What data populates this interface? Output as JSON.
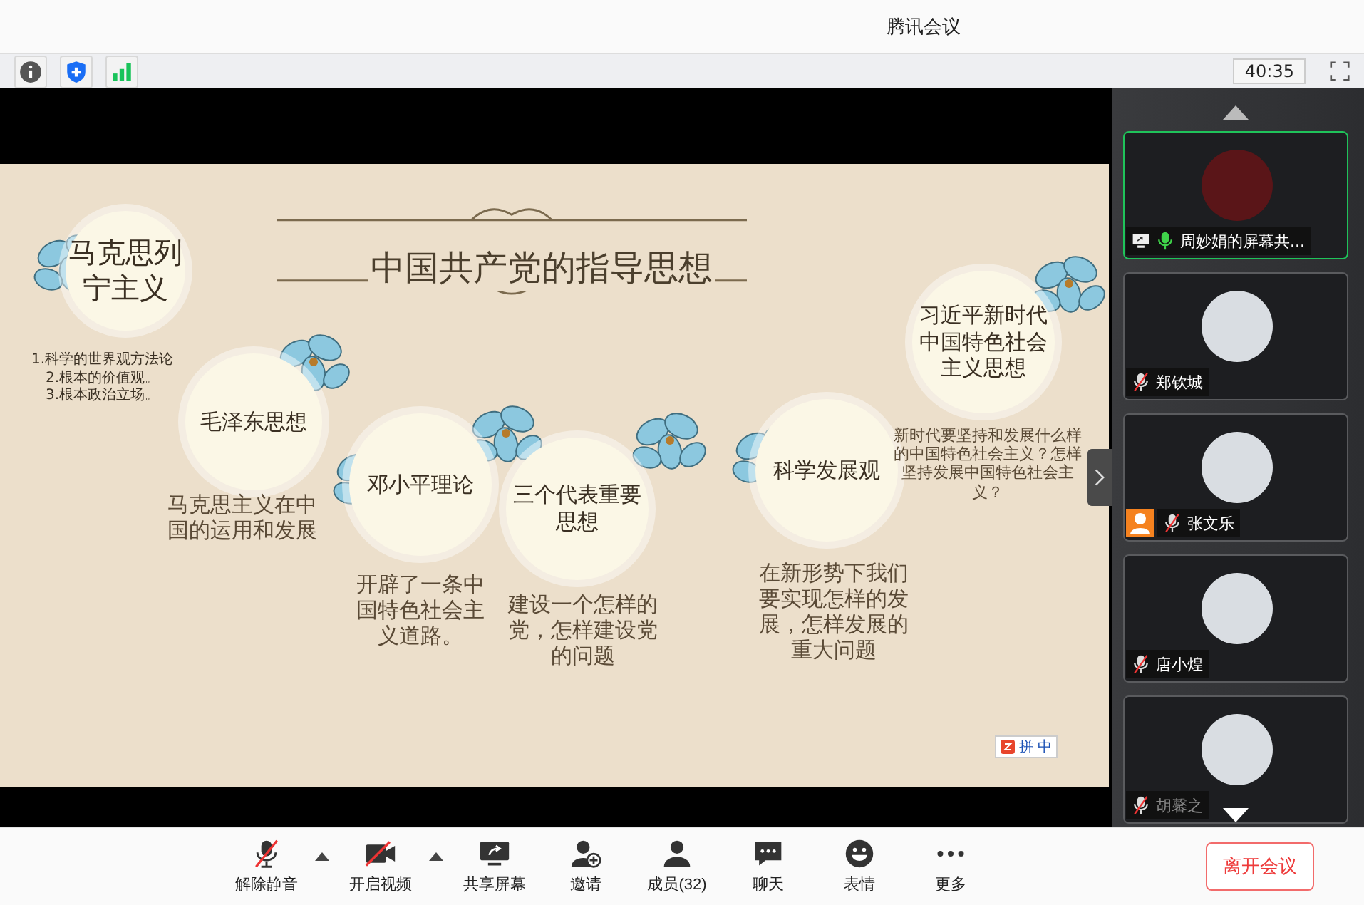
{
  "window": {
    "title": "腾讯会议"
  },
  "toolbar": {
    "timer": "40:35"
  },
  "slide": {
    "title": "中国共产党的指导思想",
    "points": [
      "1.科学的世界观方法论",
      "2.根本的价值观。",
      "3.根本政治立场。"
    ],
    "nodes": [
      {
        "label": "马克思列宁主义"
      },
      {
        "label": "毛泽东思想",
        "desc": "马克思主义在中国的运用和发展"
      },
      {
        "label": "邓小平理论",
        "desc": "开辟了一条中国特色社会主义道路。"
      },
      {
        "label": "三个代表重要思想",
        "desc": "建设一个怎样的党，怎样建设党的问题"
      },
      {
        "label": "科学发展观",
        "desc": "在新形势下我们要实现怎样的发展，怎样发展的重大问题"
      },
      {
        "label": "习近平新时代中国特色社会主义思想",
        "desc": "新时代要坚持和发展什么样的中国特色社会主义？怎样坚持发展中国特色社会主义？"
      }
    ],
    "ime": [
      "拼",
      "中"
    ]
  },
  "participants": [
    {
      "name": "周妙娟的屏幕共...",
      "mic_on": true,
      "sharing": true,
      "host": false,
      "selected": true
    },
    {
      "name": "郑钦城",
      "mic_on": false,
      "sharing": false,
      "host": false,
      "selected": false
    },
    {
      "name": "张文乐",
      "mic_on": false,
      "sharing": false,
      "host": true,
      "selected": false
    },
    {
      "name": "唐小煌",
      "mic_on": false,
      "sharing": false,
      "host": false,
      "selected": false
    },
    {
      "name": "胡馨之",
      "mic_on": false,
      "sharing": false,
      "host": false,
      "selected": false
    }
  ],
  "controls": [
    {
      "kind": "mic",
      "label": "解除静音"
    },
    {
      "kind": "caret"
    },
    {
      "kind": "video",
      "label": "开启视频"
    },
    {
      "kind": "caret"
    },
    {
      "kind": "share",
      "label": "共享屏幕"
    },
    {
      "kind": "invite",
      "label": "邀请"
    },
    {
      "kind": "members",
      "label": "成员(32)"
    },
    {
      "kind": "chat",
      "label": "聊天"
    },
    {
      "kind": "emoji",
      "label": "表情"
    },
    {
      "kind": "more",
      "label": "更多"
    }
  ],
  "leave_button": "离开会议"
}
